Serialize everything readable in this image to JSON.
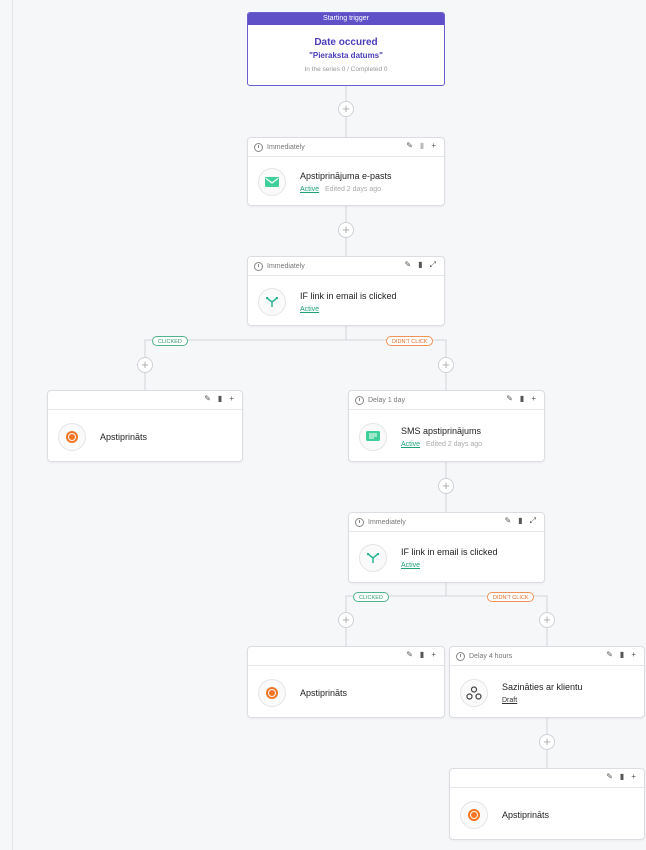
{
  "trigger": {
    "header": "Starting trigger",
    "title": "Date occured",
    "subtitle": "\"Pieraksta datums\"",
    "stats": "In the series 0 / Completed 0"
  },
  "steps": [
    {
      "timing": "Immediately",
      "name": "Apstiprinājuma e-pasts",
      "status": "Active",
      "edited": "Edited 2 days ago",
      "icon": "email-icon"
    },
    {
      "timing": "Immediately",
      "name": "IF link in email is clicked",
      "status": "Active",
      "icon": "branch-icon"
    },
    {
      "timing": "",
      "name": "Apstiprināts",
      "icon": "target-icon"
    },
    {
      "timing": "Delay 1 day",
      "name": "SMS apstiprinājums",
      "status": "Active",
      "edited": "Edited 2 days ago",
      "icon": "sms-icon"
    },
    {
      "timing": "Immediately",
      "name": "IF link in email is clicked",
      "status": "Active",
      "icon": "branch-icon"
    },
    {
      "timing": "",
      "name": "Apstiprināts",
      "icon": "target-icon"
    },
    {
      "timing": "Delay 4 hours",
      "name": "Sazināties ar klientu",
      "status": "Draft",
      "icon": "webhook-icon"
    },
    {
      "timing": "",
      "name": "Apstiprināts",
      "icon": "target-icon"
    }
  ],
  "branches": {
    "clicked": "Clicked",
    "didnt_click": "Didn't click"
  },
  "tools": {
    "edit": "✎",
    "delete": "▮",
    "add": "+",
    "expand": "⤢"
  },
  "add_symbol": "+",
  "colors": {
    "accent": "#5f50c7",
    "active": "#1fa27a",
    "orange": "#f37521",
    "email": "#3ecf9a"
  }
}
